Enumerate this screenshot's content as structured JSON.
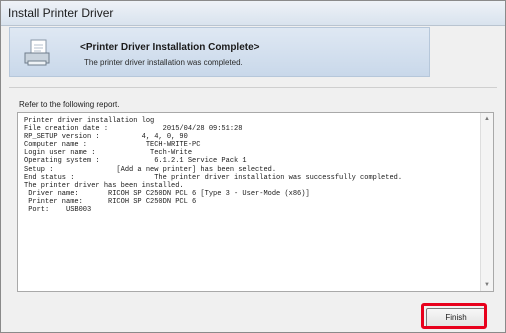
{
  "window": {
    "title": "Install Printer Driver"
  },
  "header": {
    "title": "<Printer Driver Installation Complete>",
    "subtitle": "The printer driver installation was completed.",
    "icon": "printer-document-icon"
  },
  "body": {
    "refer_label": "Refer to the following report.",
    "log_lines": [
      "Printer driver installation log",
      "File creation date :             2015/04/28 09:51:28",
      "RP_SETUP version :          4, 4, 0, 90",
      "Computer name :              TECH-WRITE-PC",
      "Login user name :             Tech-Write",
      "Operating system :             6.1.2.1 Service Pack 1",
      "Setup :               [Add a new printer] has been selected.",
      "End status :                   The printer driver installation was successfully completed.",
      "",
      "The printer driver has been installed.",
      " Driver name:       RICOH SP C250DN PCL 6 [Type 3 - User-Mode (x86)]",
      " Printer name:      RICOH SP C250DN PCL 6",
      " Port:    USB003"
    ]
  },
  "footer": {
    "finish_label": "Finish",
    "highlight_color": "#e8001c"
  }
}
